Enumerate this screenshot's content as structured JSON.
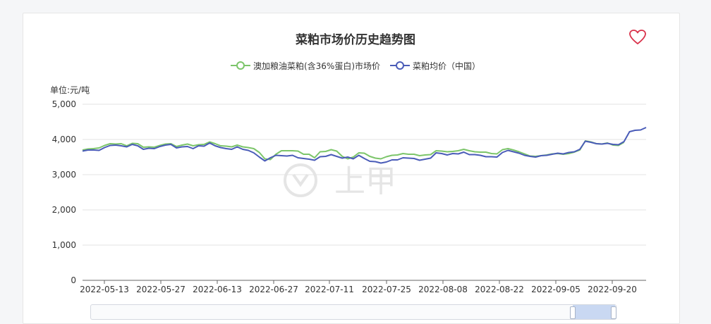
{
  "icons": {
    "favorite": "heart-outline-icon"
  },
  "colors": {
    "series1": "#7cc56a",
    "series2": "#4a5cb8",
    "favorite": "#d9314a"
  },
  "chart_data": {
    "type": "line",
    "title": "菜粕市场价历史趋势图",
    "ylabel": "单位:元/吨",
    "ylim": [
      0,
      5000
    ],
    "yticks": [
      0,
      1000,
      2000,
      3000,
      4000,
      5000
    ],
    "ytick_labels": [
      "0",
      "1,000",
      "2,000",
      "3,000",
      "4,000",
      "5,000"
    ],
    "xticks": [
      "2022-05-13",
      "2022-05-27",
      "2022-06-13",
      "2022-06-27",
      "2022-07-11",
      "2022-07-25",
      "2022-08-08",
      "2022-08-22",
      "2022-09-05",
      "2022-09-20"
    ],
    "grid": true,
    "legend": "top-center",
    "watermark": "上甲",
    "series": [
      {
        "name": "澳加粮油菜粕(含36%蛋白)市场价",
        "color": "#7cc56a",
        "values": [
          3700,
          3730,
          3740,
          3760,
          3830,
          3880,
          3870,
          3880,
          3820,
          3890,
          3880,
          3780,
          3790,
          3780,
          3830,
          3870,
          3880,
          3800,
          3840,
          3870,
          3820,
          3850,
          3860,
          3930,
          3880,
          3820,
          3810,
          3790,
          3840,
          3790,
          3770,
          3740,
          3630,
          3450,
          3430,
          3580,
          3680,
          3680,
          3680,
          3670,
          3580,
          3580,
          3480,
          3650,
          3660,
          3710,
          3670,
          3520,
          3450,
          3500,
          3620,
          3610,
          3520,
          3470,
          3450,
          3510,
          3550,
          3560,
          3600,
          3580,
          3580,
          3540,
          3560,
          3570,
          3680,
          3670,
          3650,
          3660,
          3680,
          3720,
          3680,
          3650,
          3640,
          3640,
          3600,
          3590,
          3710,
          3740,
          3700,
          3650,
          3590,
          3530,
          3520,
          3540,
          3560,
          3590,
          3600,
          3580,
          3600,
          3640,
          3700,
          3960,
          3930,
          3880,
          3870,
          3900,
          3840,
          3830,
          3920
        ]
      },
      {
        "name": "菜粕均价（中国）",
        "color": "#4a5cb8",
        "values": [
          3670,
          3700,
          3700,
          3690,
          3770,
          3830,
          3840,
          3820,
          3790,
          3860,
          3820,
          3720,
          3750,
          3740,
          3800,
          3840,
          3860,
          3760,
          3790,
          3800,
          3740,
          3820,
          3810,
          3900,
          3820,
          3770,
          3740,
          3720,
          3790,
          3720,
          3690,
          3620,
          3500,
          3390,
          3480,
          3550,
          3540,
          3530,
          3550,
          3480,
          3460,
          3440,
          3410,
          3510,
          3520,
          3570,
          3520,
          3470,
          3500,
          3450,
          3550,
          3460,
          3380,
          3370,
          3330,
          3360,
          3420,
          3420,
          3480,
          3470,
          3460,
          3410,
          3440,
          3470,
          3620,
          3600,
          3560,
          3600,
          3590,
          3640,
          3570,
          3570,
          3550,
          3510,
          3510,
          3500,
          3630,
          3690,
          3650,
          3610,
          3550,
          3520,
          3500,
          3540,
          3550,
          3580,
          3610,
          3590,
          3630,
          3650,
          3720,
          3950,
          3920,
          3880,
          3870,
          3890,
          3860,
          3850,
          3940,
          4220,
          4260,
          4270,
          4340
        ]
      }
    ]
  }
}
